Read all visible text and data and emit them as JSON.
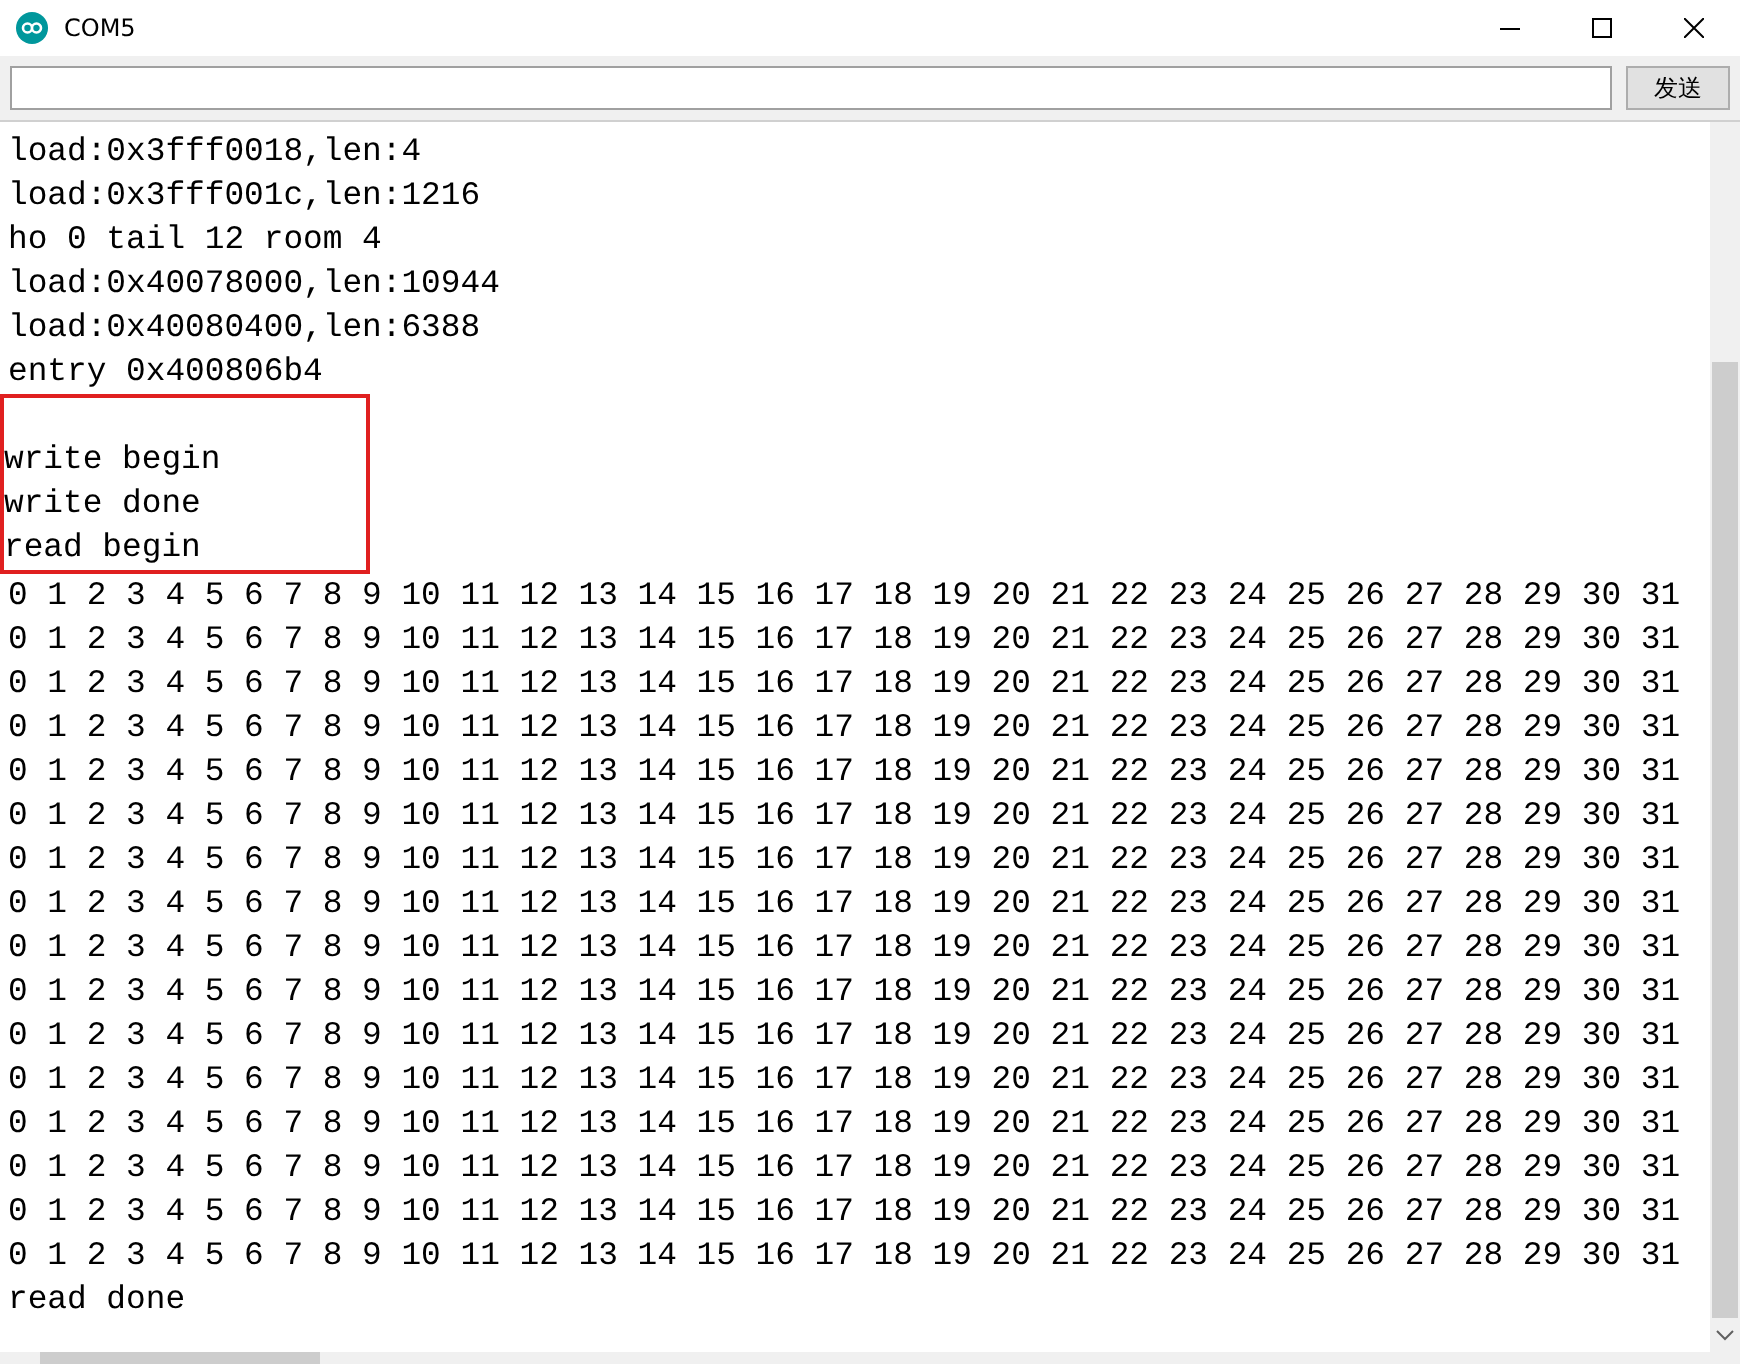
{
  "window": {
    "title": "COM5"
  },
  "send_bar": {
    "button": "发送"
  },
  "output": [
    {
      "boxed": false,
      "lines": [
        "load:0x3fff0018,len:4",
        "load:0x3fff001c,len:1216",
        "ho 0 tail 12 room 4",
        "load:0x40078000,len:10944",
        "load:0x40080400,len:6388",
        "entry 0x400806b4"
      ]
    },
    {
      "boxed": true,
      "lines": [
        "write begin",
        "write done",
        "read begin"
      ]
    },
    {
      "boxed": false,
      "lines": [
        "0 1 2 3 4 5 6 7 8 9 10 11 12 13 14 15 16 17 18 19 20 21 22 23 24 25 26 27 28 29 30 31",
        "0 1 2 3 4 5 6 7 8 9 10 11 12 13 14 15 16 17 18 19 20 21 22 23 24 25 26 27 28 29 30 31",
        "0 1 2 3 4 5 6 7 8 9 10 11 12 13 14 15 16 17 18 19 20 21 22 23 24 25 26 27 28 29 30 31",
        "0 1 2 3 4 5 6 7 8 9 10 11 12 13 14 15 16 17 18 19 20 21 22 23 24 25 26 27 28 29 30 31",
        "0 1 2 3 4 5 6 7 8 9 10 11 12 13 14 15 16 17 18 19 20 21 22 23 24 25 26 27 28 29 30 31",
        "0 1 2 3 4 5 6 7 8 9 10 11 12 13 14 15 16 17 18 19 20 21 22 23 24 25 26 27 28 29 30 31",
        "0 1 2 3 4 5 6 7 8 9 10 11 12 13 14 15 16 17 18 19 20 21 22 23 24 25 26 27 28 29 30 31",
        "0 1 2 3 4 5 6 7 8 9 10 11 12 13 14 15 16 17 18 19 20 21 22 23 24 25 26 27 28 29 30 31",
        "0 1 2 3 4 5 6 7 8 9 10 11 12 13 14 15 16 17 18 19 20 21 22 23 24 25 26 27 28 29 30 31",
        "0 1 2 3 4 5 6 7 8 9 10 11 12 13 14 15 16 17 18 19 20 21 22 23 24 25 26 27 28 29 30 31",
        "0 1 2 3 4 5 6 7 8 9 10 11 12 13 14 15 16 17 18 19 20 21 22 23 24 25 26 27 28 29 30 31",
        "0 1 2 3 4 5 6 7 8 9 10 11 12 13 14 15 16 17 18 19 20 21 22 23 24 25 26 27 28 29 30 31",
        "0 1 2 3 4 5 6 7 8 9 10 11 12 13 14 15 16 17 18 19 20 21 22 23 24 25 26 27 28 29 30 31",
        "0 1 2 3 4 5 6 7 8 9 10 11 12 13 14 15 16 17 18 19 20 21 22 23 24 25 26 27 28 29 30 31",
        "0 1 2 3 4 5 6 7 8 9 10 11 12 13 14 15 16 17 18 19 20 21 22 23 24 25 26 27 28 29 30 31",
        "0 1 2 3 4 5 6 7 8 9 10 11 12 13 14 15 16 17 18 19 20 21 22 23 24 25 26 27 28 29 30 31",
        "read done"
      ]
    }
  ]
}
